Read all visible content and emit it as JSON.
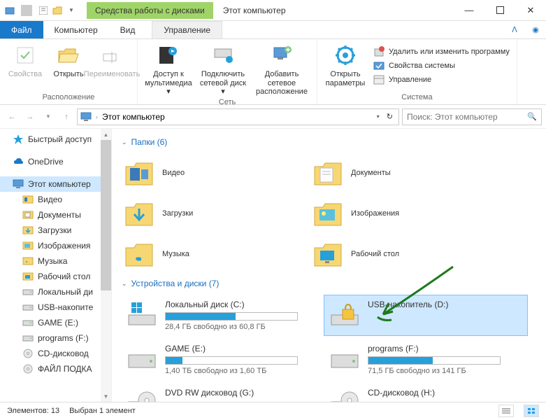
{
  "titlebar": {
    "disk_tools": "Средства работы с дисками",
    "title": "Этот компьютер"
  },
  "tabs": {
    "file": "Файл",
    "computer": "Компьютер",
    "view": "Вид",
    "manage": "Управление"
  },
  "ribbon": {
    "group1": {
      "properties": "Свойства",
      "open": "Открыть",
      "rename": "Переименовать",
      "label": "Расположение"
    },
    "group2": {
      "media": "Доступ к мультимедиа ▾",
      "netdrive": "Подключить сетевой диск ▾",
      "addnet": "Добавить сетевое расположение",
      "label": "Сеть"
    },
    "group3": {
      "open_params": "Открыть параметры",
      "uninstall": "Удалить или изменить программу",
      "sysprops": "Свойства системы",
      "manage": "Управление",
      "label": "Система"
    }
  },
  "addressbar": {
    "path": "Этот компьютер",
    "search_placeholder": "Поиск: Этот компьютер"
  },
  "sidebar": {
    "items": [
      {
        "label": "Быстрый доступ",
        "icon": "star"
      },
      {
        "label": "OneDrive",
        "icon": "cloud"
      },
      {
        "label": "Этот компьютер",
        "icon": "pc",
        "selected": true
      },
      {
        "label": "Видео",
        "icon": "video"
      },
      {
        "label": "Документы",
        "icon": "doc"
      },
      {
        "label": "Загрузки",
        "icon": "download"
      },
      {
        "label": "Изображения",
        "icon": "image"
      },
      {
        "label": "Музыка",
        "icon": "music"
      },
      {
        "label": "Рабочий стол",
        "icon": "desktop"
      },
      {
        "label": "Локальный ди",
        "icon": "drive"
      },
      {
        "label": "USB-накопите",
        "icon": "drive"
      },
      {
        "label": "GAME (E:)",
        "icon": "drive"
      },
      {
        "label": "programs (F:)",
        "icon": "drive"
      },
      {
        "label": "CD-дисковод",
        "icon": "cd"
      },
      {
        "label": "ФАЙЛ ПОДКА",
        "icon": "cd"
      }
    ]
  },
  "sections": {
    "folders": {
      "title": "Папки (6)"
    },
    "devices": {
      "title": "Устройства и диски (7)"
    }
  },
  "folders": [
    {
      "label": "Видео",
      "icon": "video"
    },
    {
      "label": "Документы",
      "icon": "doc"
    },
    {
      "label": "Загрузки",
      "icon": "download"
    },
    {
      "label": "Изображения",
      "icon": "image"
    },
    {
      "label": "Музыка",
      "icon": "music"
    },
    {
      "label": "Рабочий стол",
      "icon": "desktop"
    }
  ],
  "drives": [
    {
      "label": "Локальный диск (C:)",
      "sub": "28,4 ГБ свободно из 60,8 ГБ",
      "fill": 53,
      "icon": "win"
    },
    {
      "label": "USB-накопитель (D:)",
      "sub": "",
      "fill": 0,
      "icon": "usb-lock",
      "selected": true
    },
    {
      "label": "GAME (E:)",
      "sub": "1,40 ТБ свободно из 1,60 ТБ",
      "fill": 13,
      "icon": "hdd"
    },
    {
      "label": "programs (F:)",
      "sub": "71,5 ГБ свободно из 141 ГБ",
      "fill": 49,
      "icon": "hdd"
    },
    {
      "label": "DVD RW дисковод (G:)",
      "sub": "",
      "fill": 0,
      "icon": "dvd",
      "nobar": true
    },
    {
      "label": "CD-дисковод (H:)",
      "sub": "",
      "fill": 0,
      "icon": "cd",
      "nobar": true
    }
  ],
  "status": {
    "count": "Элементов: 13",
    "selected": "Выбран 1 элемент"
  }
}
